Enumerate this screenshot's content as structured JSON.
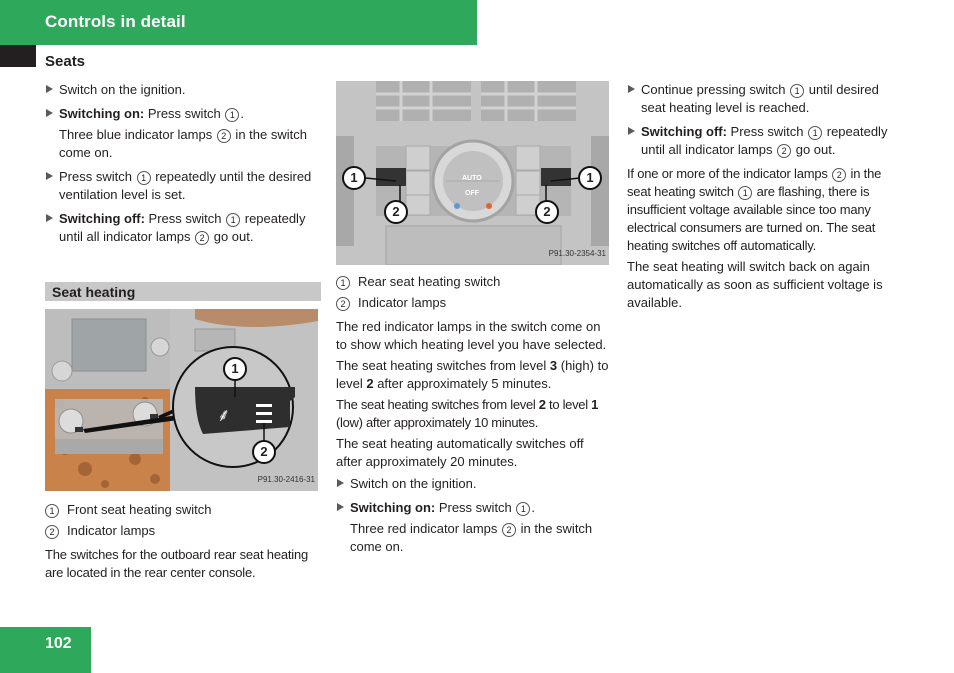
{
  "header": {
    "title": "Controls in detail",
    "color": "#2ea85a"
  },
  "section": {
    "title": "Seats"
  },
  "col1": {
    "steps_top": [
      {
        "bold": "",
        "text": "Switch on the ignition."
      },
      {
        "bold": "Switching on:",
        "text": " Press switch ",
        "ref": "1",
        "after": "."
      }
    ],
    "sub1": {
      "pre": "Three blue indicator lamps ",
      "ref": "2",
      "post": " in the switch come on."
    },
    "step3": {
      "pre": "Press switch ",
      "ref": "1",
      "post": " repeatedly until the desired ventilation level is set."
    },
    "step4": {
      "bold": "Switching off:",
      "pre": " Press switch ",
      "ref1": "1",
      "mid": " repeatedly until all indicator lamps ",
      "ref2": "2",
      "post": " go out."
    },
    "subheading": "Seat heating",
    "photo_code": "P91.30-2416-31",
    "legend": [
      {
        "num": "1",
        "label": "Front seat heating switch"
      },
      {
        "num": "2",
        "label": "Indicator lamps"
      }
    ],
    "note": "The switches for the outboard rear seat heating are located in the rear center console."
  },
  "col2": {
    "photo_code": "P91.30-2354-31",
    "photo_labels": {
      "auto": "AUTO",
      "off": "OFF"
    },
    "legend": [
      {
        "num": "1",
        "label": "Rear seat heating switch"
      },
      {
        "num": "2",
        "label": "Indicator lamps"
      }
    ],
    "para1": "The red indicator lamps in the switch come on to show which heating level you have selected.",
    "para2": {
      "pre": "The seat heating switches from level ",
      "b1": "3",
      "mid": " (high) to level ",
      "b2": "2",
      "post": " after approximately 5 minutes."
    },
    "para3": {
      "pre": "The seat heating switches from level ",
      "b1": "2",
      "mid": " to level ",
      "b2": "1",
      "post": " (low) after approximately 10 minutes."
    },
    "para4": "The seat heating automatically switches off after approximately 20 minutes.",
    "step1": "Switch on the ignition.",
    "step2": {
      "bold": "Switching on:",
      "pre": " Press switch ",
      "ref": "1",
      "post": "."
    },
    "sub": {
      "pre": "Three red indicator lamps ",
      "ref": "2",
      "post": " in the switch come on."
    }
  },
  "col3": {
    "step1": {
      "pre": "Continue pressing switch ",
      "ref": "1",
      "post": " until desired seat heating level is reached."
    },
    "step2": {
      "bold": "Switching off:",
      "pre": " Press switch ",
      "ref1": "1",
      "mid": " repeatedly until all indicator lamps ",
      "ref2": "2",
      "post": " go out."
    },
    "para1": {
      "pre": "If one or more of the indicator lamps ",
      "ref1": "2",
      "mid": " in the seat heating switch ",
      "ref2": "1",
      "post": " are flashing, there is insufficient voltage available since too many electrical consumers are turned on. The seat heating switches off automatically."
    },
    "para2": "The seat heating will switch back on again automatically as soon as sufficient voltage is available."
  },
  "footer": {
    "page_number": "102"
  }
}
